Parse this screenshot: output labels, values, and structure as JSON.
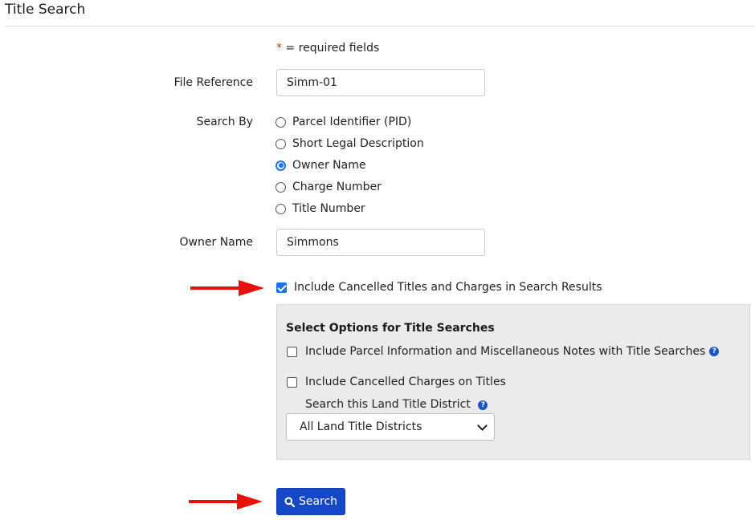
{
  "page": {
    "title": "Title Search"
  },
  "form": {
    "required_star": "*",
    "required_note": "= required fields",
    "file_reference_label": "File Reference",
    "file_reference_value": "Simm-01",
    "search_by_label": "Search By",
    "search_by_options": [
      {
        "label": "Parcel Identifier (PID)",
        "selected": false
      },
      {
        "label": "Short Legal Description",
        "selected": false
      },
      {
        "label": "Owner Name",
        "selected": true
      },
      {
        "label": "Charge Number",
        "selected": false
      },
      {
        "label": "Title Number",
        "selected": false
      }
    ],
    "owner_name_label": "Owner Name",
    "owner_name_value": "Simmons",
    "include_cancelled_label": "Include Cancelled Titles and Charges in Search Results",
    "include_cancelled_checked": true
  },
  "options_panel": {
    "heading": "Select Options for Title Searches",
    "parcel_info_label": "Include Parcel Information and Miscellaneous Notes with Title Searches",
    "parcel_info_checked": false,
    "cancelled_charges_label": "Include Cancelled Charges on Titles",
    "cancelled_charges_checked": false,
    "district_label": "Search this Land Title District",
    "district_selected": "All Land Title Districts"
  },
  "actions": {
    "search_label": "Search"
  },
  "icons": {
    "help": "question-circle-icon",
    "search": "magnifier-icon",
    "annotation": "red-arrow-icon"
  },
  "colors": {
    "accent": "#1a73e8",
    "button": "#1548c9",
    "required": "#d9261c",
    "arrow": "#e8100b"
  }
}
